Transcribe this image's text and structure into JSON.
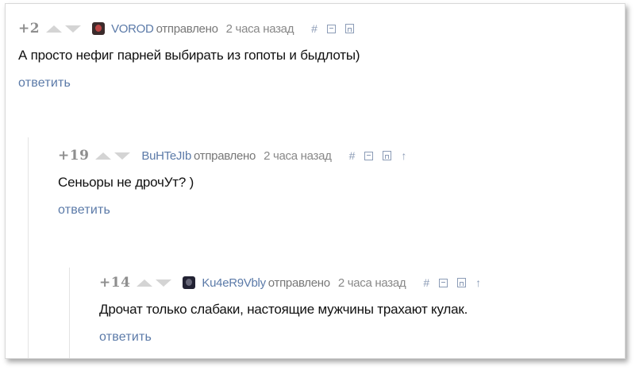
{
  "comments": [
    {
      "rating": "+2",
      "username": "VOROD",
      "sent_label": "отправлено",
      "time": "2 часа назад",
      "hash_icon": "#",
      "text": "А просто нефиг парней выбирать из гопоты и быдлоты)",
      "reply_label": "ответить",
      "icons": [
        "hash-icon",
        "collapse-icon",
        "save-icon"
      ]
    },
    {
      "rating": "+19",
      "username": "BuHTeJIb",
      "sent_label": "отправлено",
      "time": "2 часа назад",
      "hash_icon": "#",
      "up_icon": "↑",
      "text": "Сеньоры не дрочУт? )",
      "reply_label": "ответить",
      "icons": [
        "hash-icon",
        "collapse-icon",
        "save-icon",
        "parent-arrow-icon"
      ]
    },
    {
      "rating": "+14",
      "username": "Ku4eR9Vbly",
      "sent_label": "отправлено",
      "time": "2 часа назад",
      "hash_icon": "#",
      "up_icon": "↑",
      "text": "Дрочат только слабаки, настоящие мужчины трахают кулак.",
      "reply_label": "ответить",
      "icons": [
        "hash-icon",
        "collapse-icon",
        "save-icon",
        "parent-arrow-icon"
      ]
    }
  ],
  "colors": {
    "link": "#5b7aa8",
    "rating": "#8e8e8e",
    "icon": "#8b9bb6",
    "text": "#111111"
  }
}
